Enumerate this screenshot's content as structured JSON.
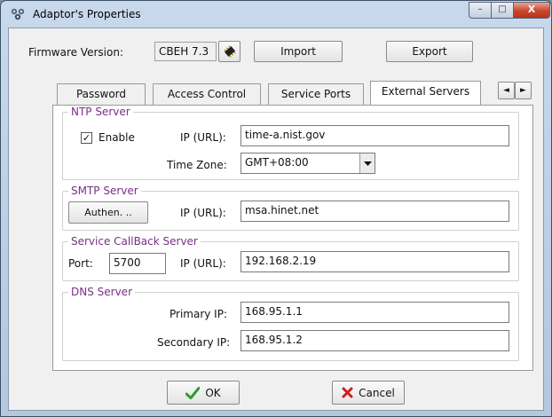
{
  "window": {
    "title": "Adaptor's Properties",
    "controls": {
      "minimize": "–",
      "maximize": "□",
      "close": "X"
    }
  },
  "firmware": {
    "label": "Firmware Version:",
    "value": "CBEH 7.3",
    "chip_icon": "chip-icon",
    "import_label": "Import",
    "export_label": "Export"
  },
  "tabs": [
    {
      "label": "Password"
    },
    {
      "label": "Access Control"
    },
    {
      "label": "Service Ports"
    },
    {
      "label": "External Servers",
      "active": true
    }
  ],
  "tab_scroll": {
    "left": "◄",
    "right": "►"
  },
  "ntp": {
    "legend": "NTP Server",
    "enable_label": "Enable",
    "enable_checked": true,
    "check_mark": "✓",
    "ip_label": "IP (URL):",
    "ip_value": "time-a.nist.gov",
    "tz_label": "Time Zone:",
    "tz_value": "GMT+08:00"
  },
  "smtp": {
    "legend": "SMTP Server",
    "authen_label": "Authen. ..",
    "ip_label": "IP (URL):",
    "ip_value": "msa.hinet.net"
  },
  "callback": {
    "legend": "Service CallBack Server",
    "port_label": "Port:",
    "port_value": "5700",
    "ip_label": "IP (URL):",
    "ip_value": "192.168.2.19"
  },
  "dns": {
    "legend": "DNS Server",
    "primary_label": "Primary IP:",
    "primary_value": "168.95.1.1",
    "secondary_label": "Secondary IP:",
    "secondary_value": "168.95.1.2"
  },
  "footer": {
    "ok_label": "OK",
    "cancel_label": "Cancel"
  },
  "colors": {
    "legend": "#7a2f86",
    "ok_check": "#2f9b2f",
    "cancel_x": "#cc1f1f"
  }
}
